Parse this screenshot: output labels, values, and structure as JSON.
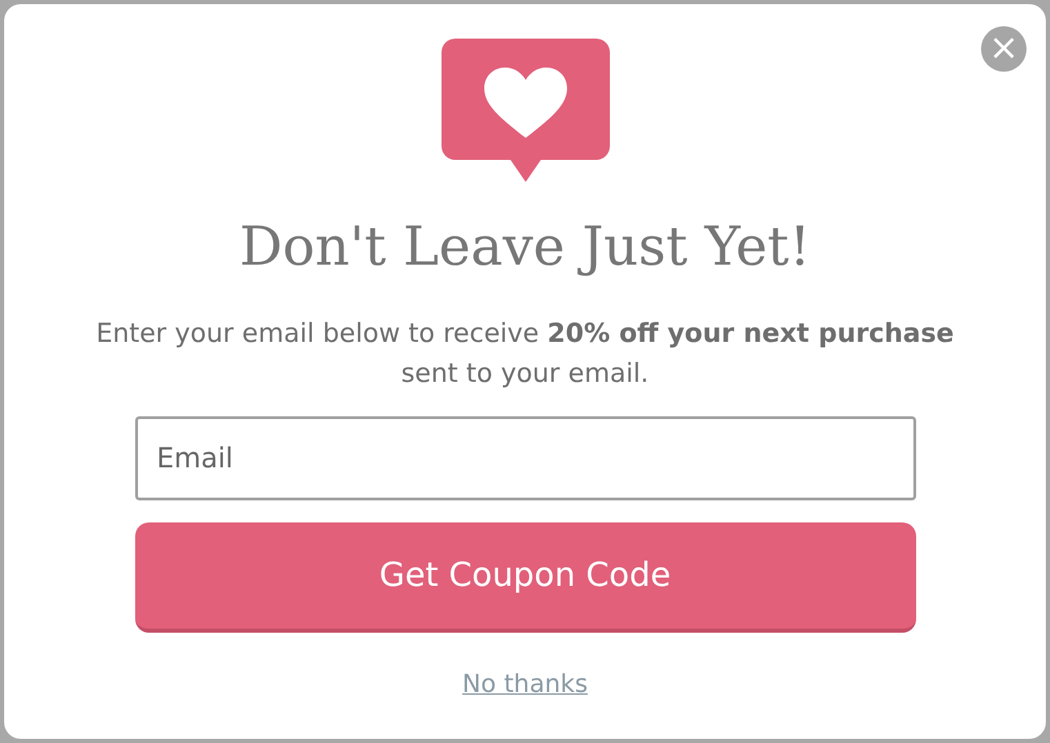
{
  "close_button": {
    "label": "×"
  },
  "title": "Don't Leave Just Yet!",
  "message": "Enter your email below to receive **20% off your next purchase** sent to your email.",
  "email_field": {
    "placeholder": "Email"
  },
  "submit_button": {
    "label": "Get Coupon Code"
  },
  "dismiss_link": {
    "label": "No thanks"
  }
}
